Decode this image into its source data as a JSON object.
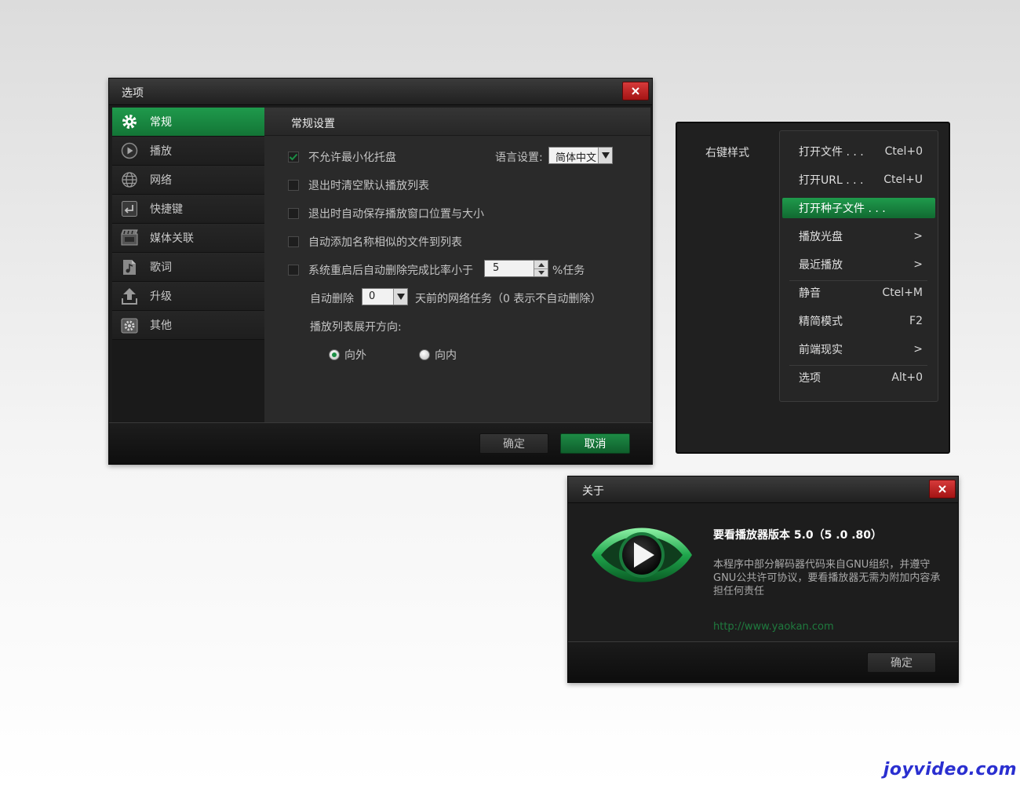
{
  "options": {
    "title": "选项",
    "sidebar": [
      {
        "label": "常规",
        "icon": "gear-icon"
      },
      {
        "label": "播放",
        "icon": "play-icon"
      },
      {
        "label": "网络",
        "icon": "globe-icon"
      },
      {
        "label": "快捷键",
        "icon": "keyboard-return-icon"
      },
      {
        "label": "媒体关联",
        "icon": "film-icon"
      },
      {
        "label": "歌词",
        "icon": "music-note-icon"
      },
      {
        "label": "升级",
        "icon": "upload-arrow-icon"
      },
      {
        "label": "其他",
        "icon": "settings-box-icon"
      }
    ],
    "section_title": "常规设置",
    "checkboxes": [
      {
        "label": "不允许最小化托盘",
        "checked": true
      },
      {
        "label": "退出时清空默认播放列表",
        "checked": false
      },
      {
        "label": "退出时自动保存播放窗口位置与大小",
        "checked": false
      },
      {
        "label": "自动添加名称相似的文件到列表",
        "checked": false
      },
      {
        "label": "系统重启后自动删除完成比率小于",
        "checked": false
      }
    ],
    "language_label": "语言设置:",
    "language_value": "简体中文",
    "ratio_value": "5",
    "ratio_suffix": "%任务",
    "auto_delete_label": "自动删除",
    "auto_delete_value": "0",
    "auto_delete_suffix": "天前的网络任务（0 表示不自动删除）",
    "expand_label": "播放列表展开方向:",
    "radio_out": "向外",
    "radio_in": "向内",
    "ok_label": "确定",
    "cancel_label": "取消"
  },
  "context": {
    "label": "右键样式",
    "items": [
      {
        "label": "打开文件 . . .",
        "shortcut": "Ctel+0"
      },
      {
        "label": "打开URL . . .",
        "shortcut": "Ctel+U"
      },
      {
        "label": "打开种子文件 . . .",
        "shortcut": ""
      },
      {
        "label": "播放光盘",
        "shortcut": ">"
      },
      {
        "label": "最近播放",
        "shortcut": ">"
      },
      {
        "label": "静音",
        "shortcut": "Ctel+M"
      },
      {
        "label": "精简模式",
        "shortcut": "F2"
      },
      {
        "label": "前端现实",
        "shortcut": ">"
      },
      {
        "label": "选项",
        "shortcut": "Alt+0"
      }
    ]
  },
  "about": {
    "title": "关于",
    "version": "要看播放器版本 5.0（5 .0 .80）",
    "description": "本程序中部分解码器代码来自GNU组织，并遵守GNU公共许可协议，要看播放器无需为附加内容承担任何责任",
    "url": "http://www.yaokan.com",
    "ok_label": "确定"
  },
  "watermark": "joyvideo.com",
  "colors": {
    "accent_green": "#1b8f45",
    "close_red": "#c42626",
    "link_green": "#1f7a3e",
    "watermark_blue": "#2a2fd0"
  }
}
